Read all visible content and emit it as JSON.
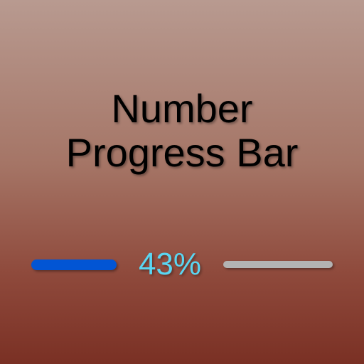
{
  "title": {
    "line1": "Number",
    "line2": "Progress Bar"
  },
  "progress": {
    "value": 43,
    "label": "43%",
    "fill_color": "#0255d4",
    "track_color": "#b3b3b3",
    "text_color": "#5ad6f2"
  }
}
